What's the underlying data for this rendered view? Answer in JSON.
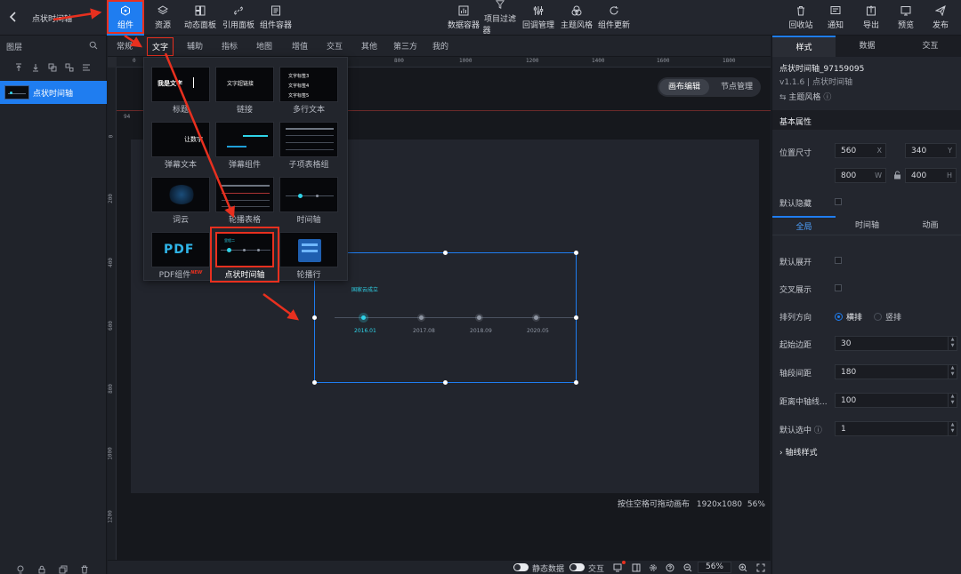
{
  "app": {
    "back_icon": "chevron-left-icon",
    "title": "点状时间轴"
  },
  "toolbar": {
    "left": [
      {
        "label": "组件",
        "icon": "component-icon",
        "active": true
      },
      {
        "label": "资源",
        "icon": "layers-stack-icon"
      },
      {
        "label": "动态面板",
        "icon": "panel-grid-icon"
      },
      {
        "label": "引用面板",
        "icon": "link-icon"
      },
      {
        "label": "组件容器",
        "icon": "container-icon"
      }
    ],
    "center": [
      {
        "label": "数据容器",
        "icon": "chart-box-icon"
      },
      {
        "label": "项目过滤",
        "label2": "器",
        "icon": "filter-icon"
      },
      {
        "label": "回调管理",
        "icon": "sliders-icon"
      },
      {
        "label": "主题风格",
        "icon": "palette-icon"
      },
      {
        "label": "组件更新",
        "icon": "refresh-icon"
      }
    ],
    "right": [
      {
        "label": "回收站",
        "icon": "trash-icon"
      },
      {
        "label": "通知",
        "icon": "notification-icon"
      },
      {
        "label": "导出",
        "icon": "export-icon"
      },
      {
        "label": "预览",
        "icon": "preview-icon"
      },
      {
        "label": "发布",
        "icon": "send-icon"
      }
    ]
  },
  "layers": {
    "header": "图层",
    "search_icon": "search-icon",
    "selected_layer": "点状时间轴",
    "bottom_icons": [
      "bulb-icon",
      "lock-icon",
      "copy-icon",
      "delete-icon"
    ]
  },
  "categories": [
    "常规",
    "文字",
    "辅助",
    "指标",
    "地图",
    "增值",
    "交互",
    "其他",
    "第三方",
    "我的"
  ],
  "active_category": "文字",
  "ruler": {
    "h_marks": [
      "0",
      "800",
      "1000",
      "1200",
      "1400",
      "1600",
      "1800"
    ],
    "v_marks": [
      "0",
      "200",
      "400",
      "600",
      "800",
      "1000",
      "1200"
    ],
    "guide_value": "94"
  },
  "canvas_tabs": {
    "active": "画布编辑",
    "other": "节点管理"
  },
  "popup": {
    "items": [
      {
        "label": "标题",
        "preview": "我是文字"
      },
      {
        "label": "链接",
        "preview": "文字超链接"
      },
      {
        "label": "多行文本",
        "preview": [
          "文字标签3",
          "文字标签4",
          "文字标签5"
        ]
      },
      {
        "label": "弹幕文本",
        "preview": "让数字"
      },
      {
        "label": "弹幕组件"
      },
      {
        "label": "子项表格组"
      },
      {
        "label": "词云"
      },
      {
        "label": "轮播表格"
      },
      {
        "label": "时间轴"
      },
      {
        "label": "PDF组件",
        "badge": "NEW",
        "preview": "PDF"
      },
      {
        "label": "点状时间轴",
        "highlighted": true,
        "preview": "里程二"
      },
      {
        "label": "轮播行"
      }
    ]
  },
  "timeline": {
    "title": "国家云成立",
    "dates": [
      "2016.01",
      "2017.08",
      "2018.09",
      "2020.05"
    ]
  },
  "canvas_hint": "按住空格可拖动画布",
  "canvas_size": "1920x1080",
  "canvas_zoom": "56%",
  "bottombar": {
    "static_data": "静态数据",
    "interaction": "交互",
    "zoom": "56%"
  },
  "panel": {
    "tabs": [
      "样式",
      "数据",
      "交互"
    ],
    "active_tab": "样式",
    "component_id": "点状时间轴_97159095",
    "version": "v1.1.6 | 点状时间轴",
    "theme_style": "主题风格",
    "basic_section": "基本属性",
    "position_label": "位置尺寸",
    "x": "560",
    "y": "340",
    "w": "800",
    "h": "400",
    "hidden_label": "默认隐藏",
    "subtabs": [
      "全局",
      "时间轴",
      "动画"
    ],
    "expand_label": "默认展开",
    "cross_label": "交叉展示",
    "direction_label": "排列方向",
    "direction_options": [
      "横排",
      "竖排"
    ],
    "start_margin_label": "起始边距",
    "start_margin": "30",
    "axis_gap_label": "轴段间距",
    "axis_gap": "180",
    "center_dist_label": "距离中轴线...",
    "center_dist": "100",
    "default_selected_label": "默认选中",
    "default_selected": "1",
    "axis_style_label": "轴线样式"
  },
  "colors": {
    "accent": "#1f7df0",
    "cyan": "#2fd3e8",
    "annotation": "#e8301f",
    "bg": "#1b1e25"
  }
}
